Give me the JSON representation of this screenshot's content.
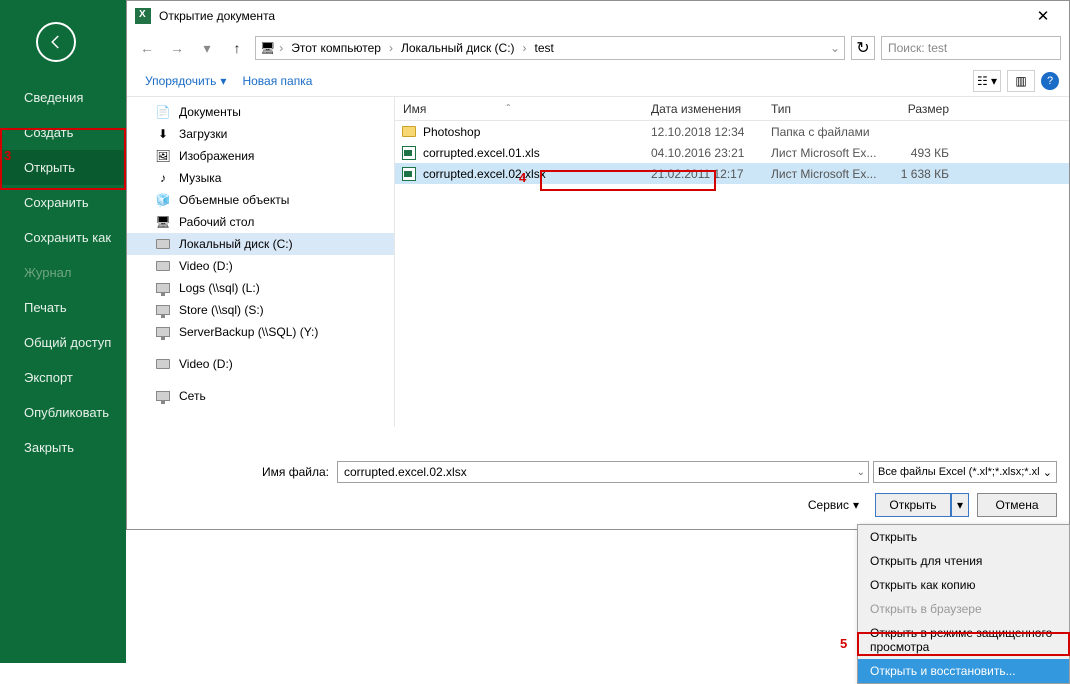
{
  "backstage": {
    "items": [
      {
        "label": "Сведения"
      },
      {
        "label": "Создать"
      },
      {
        "label": "Открыть",
        "active": true
      },
      {
        "label": "Сохранить"
      },
      {
        "label": "Сохранить как"
      },
      {
        "label": "Журнал",
        "disabled": true
      },
      {
        "label": "Печать"
      },
      {
        "label": "Общий доступ"
      },
      {
        "label": "Экспорт"
      },
      {
        "label": "Опубликовать"
      },
      {
        "label": "Закрыть"
      }
    ]
  },
  "dialog": {
    "title": "Открытие документа",
    "breadcrumb": [
      "Этот компьютер",
      "Локальный диск (C:)",
      "test"
    ],
    "search_placeholder": "Поиск: test",
    "toolbar": {
      "organize": "Упорядочить",
      "newfolder": "Новая папка"
    },
    "columns": {
      "name": "Имя",
      "date": "Дата изменения",
      "type": "Тип",
      "size": "Размер"
    },
    "tree": [
      {
        "label": "Документы",
        "icon": "docs"
      },
      {
        "label": "Загрузки",
        "icon": "down"
      },
      {
        "label": "Изображения",
        "icon": "img"
      },
      {
        "label": "Музыка",
        "icon": "music"
      },
      {
        "label": "Объемные объекты",
        "icon": "3d"
      },
      {
        "label": "Рабочий стол",
        "icon": "desk"
      },
      {
        "label": "Локальный диск (C:)",
        "icon": "drive",
        "selected": true
      },
      {
        "label": "Video (D:)",
        "icon": "drive"
      },
      {
        "label": "Logs (\\\\sql) (L:)",
        "icon": "net"
      },
      {
        "label": "Store (\\\\sql) (S:)",
        "icon": "net"
      },
      {
        "label": "ServerBackup (\\\\SQL) (Y:)",
        "icon": "net"
      },
      {
        "gap": true
      },
      {
        "label": "Video (D:)",
        "icon": "drive"
      },
      {
        "gap": true
      },
      {
        "label": "Сеть",
        "icon": "net"
      }
    ],
    "files": [
      {
        "name": "Photoshop",
        "date": "12.10.2018 12:34",
        "type": "Папка с файлами",
        "size": "",
        "icon": "folder"
      },
      {
        "name": "corrupted.excel.01.xls",
        "date": "04.10.2016 23:21",
        "type": "Лист Microsoft Ex...",
        "size": "493 КБ",
        "icon": "xls"
      },
      {
        "name": "corrupted.excel.02.xlsx",
        "date": "21.02.2011 12:17",
        "type": "Лист Microsoft Ex...",
        "size": "1 638 КБ",
        "icon": "xls",
        "selected": true
      }
    ],
    "filename_label": "Имя файла:",
    "filename_value": "corrupted.excel.02.xlsx",
    "filetype": "Все файлы Excel (*.xl*;*.xlsx;*.xl",
    "service": "Сервис",
    "open_btn": "Открыть",
    "cancel_btn": "Отмена"
  },
  "dropdown": {
    "items": [
      {
        "label": "Открыть"
      },
      {
        "label": "Открыть для чтения"
      },
      {
        "label": "Открыть как копию"
      },
      {
        "label": "Открыть в браузере",
        "disabled": true
      },
      {
        "label": "Открыть в режиме защищенного просмотра"
      },
      {
        "label": "Открыть и восстановить...",
        "highlight": true
      }
    ]
  },
  "annotations": {
    "n3": "3",
    "n4": "4",
    "n5": "5"
  }
}
